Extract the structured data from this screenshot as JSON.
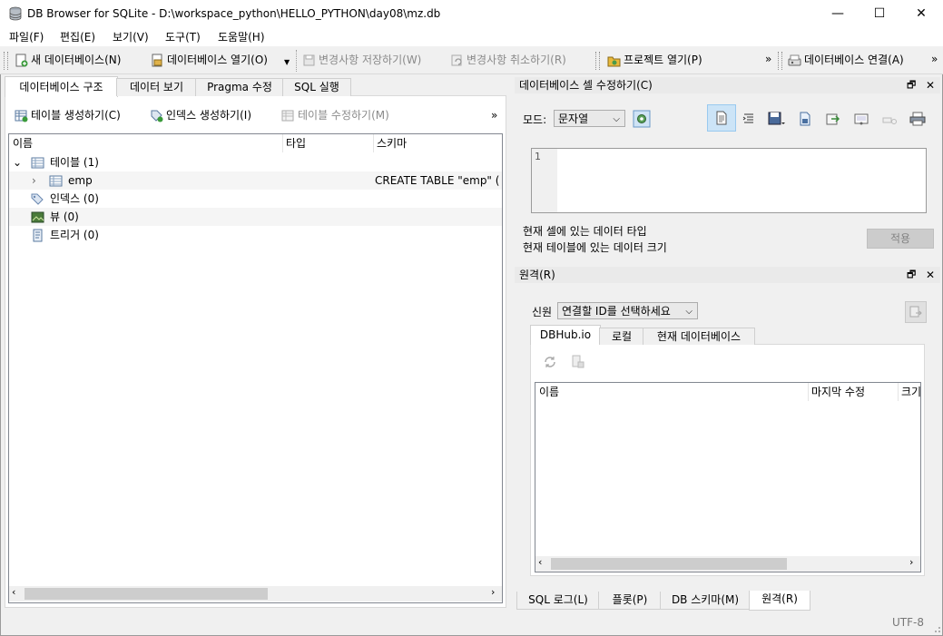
{
  "window": {
    "title": "DB Browser for SQLite - D:\\workspace_python\\HELLO_PYTHON\\day08\\mz.db",
    "controls": {
      "minimize": "—",
      "maximize": "☐",
      "close": "✕"
    }
  },
  "menu": [
    "파일(F)",
    "편집(E)",
    "보기(V)",
    "도구(T)",
    "도움말(H)"
  ],
  "toolbar": {
    "new_db": "새 데이터베이스(N)",
    "open_db": "데이터베이스 열기(O)",
    "write_changes": "변경사항 저장하기(W)",
    "revert_changes": "변경사항 취소하기(R)",
    "open_project": "프로젝트 열기(P)",
    "more1": "»",
    "attach_db": "데이터베이스 연결(A)",
    "more2": "»"
  },
  "main_tabs": [
    "데이터베이스 구조",
    "데이터 보기",
    "Pragma 수정",
    "SQL 실행"
  ],
  "structure_toolbar": {
    "create_table": "테이블 생성하기(C)",
    "create_index": "인덱스 생성하기(I)",
    "modify_table": "테이블 수정하기(M)",
    "more": "»"
  },
  "tree": {
    "columns": [
      "이름",
      "타입",
      "스키마"
    ],
    "rows": [
      {
        "expander": "⌄",
        "name": "테이블 (1)",
        "type": "",
        "schema": ""
      },
      {
        "expander": "›",
        "name": "emp",
        "type": "",
        "schema": "CREATE TABLE \"emp\" ("
      },
      {
        "expander": "",
        "name": "인덱스 (0)",
        "type": "",
        "schema": ""
      },
      {
        "expander": "",
        "name": "뷰 (0)",
        "type": "",
        "schema": ""
      },
      {
        "expander": "",
        "name": "트리거 (0)",
        "type": "",
        "schema": ""
      }
    ]
  },
  "edit_cell": {
    "title": "데이터베이스 셀 수정하기(C)",
    "mode_label": "모드:",
    "mode_value": "문자열",
    "line_number": "1",
    "data_type_text": "현재 셀에 있는 데이터 타입",
    "data_size_text": "현재 테이블에 있는 데이터 크기",
    "apply_button": "적용"
  },
  "remote": {
    "title": "원격(R)",
    "identity_label": "신원",
    "identity_value": "연결할 ID를 선택하세요",
    "tabs": [
      "DBHub.io",
      "로컬",
      "현재 데이터베이스"
    ],
    "columns": [
      "이름",
      "마지막 수정",
      "크기"
    ]
  },
  "bottom_tabs": [
    "SQL 로그(L)",
    "플롯(P)",
    "DB 스키마(M)",
    "원격(R)"
  ],
  "status": {
    "encoding": "UTF-8"
  },
  "dock_buttons": {
    "float": "🗗",
    "close": "✕"
  }
}
